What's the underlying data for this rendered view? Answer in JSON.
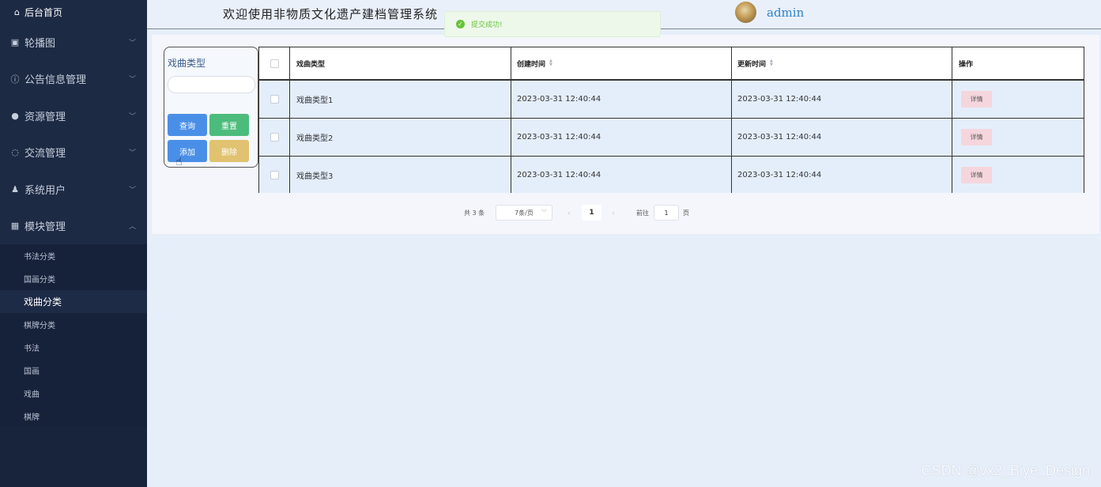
{
  "sidebar": {
    "home": "后台首页",
    "menus": [
      {
        "label": "轮播图",
        "icon": "image-icon"
      },
      {
        "label": "公告信息管理",
        "icon": "info-icon"
      },
      {
        "label": "资源管理",
        "icon": "location-icon"
      },
      {
        "label": "交流管理",
        "icon": "chat-icon"
      },
      {
        "label": "系统用户",
        "icon": "user-icon"
      },
      {
        "label": "模块管理",
        "icon": "grid-icon"
      }
    ],
    "submenu": [
      "书法分类",
      "国画分类",
      "戏曲分类",
      "棋牌分类",
      "书法",
      "国画",
      "戏曲",
      "棋牌"
    ],
    "active_submenu": "戏曲分类"
  },
  "header": {
    "title": "欢迎使用非物质文化遗产建档管理系统",
    "username": "admin"
  },
  "toast": {
    "message": "提交成功!"
  },
  "search": {
    "label": "戏曲类型",
    "placeholder": "",
    "query_button": "查询",
    "reset_button": "重置",
    "add_button": "添加",
    "delete_button": "删除"
  },
  "table": {
    "columns": [
      "戏曲类型",
      "创建时间",
      "更新时间",
      "操作"
    ],
    "rows": [
      {
        "type": "戏曲类型1",
        "created": "2023-03-31 12:40:44",
        "updated": "2023-03-31 12:40:44",
        "action": "详情"
      },
      {
        "type": "戏曲类型2",
        "created": "2023-03-31 12:40:44",
        "updated": "2023-03-31 12:40:44",
        "action": "详情"
      },
      {
        "type": "戏曲类型3",
        "created": "2023-03-31 12:40:44",
        "updated": "2023-03-31 12:40:44",
        "action": "详情"
      }
    ]
  },
  "pagination": {
    "total": "共 3 条",
    "page_size": "7条/页",
    "current_page": "1",
    "goto_label": "前往",
    "goto_value": "1",
    "page_unit": "页"
  },
  "watermark": "CSDN @vx2_Biye_Design"
}
